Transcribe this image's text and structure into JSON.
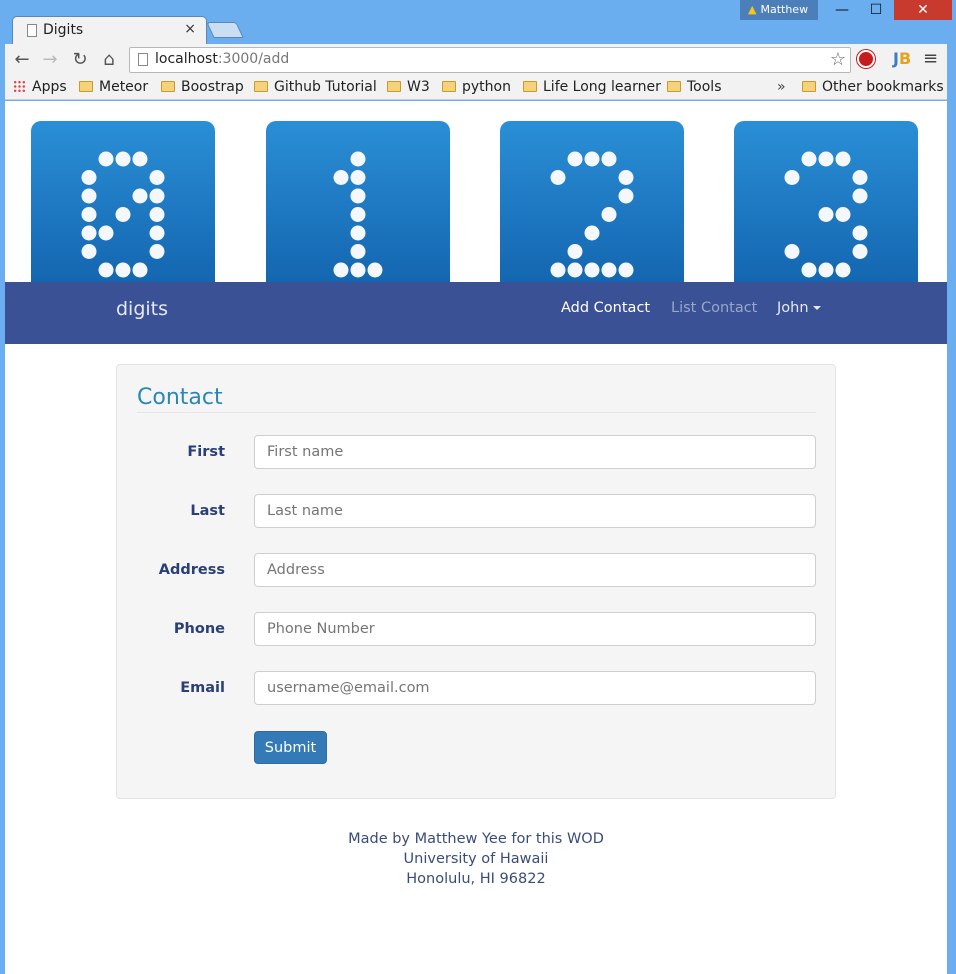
{
  "browser": {
    "tab_title": "Digits",
    "tab_close": "×",
    "profile_name": "Matthew",
    "url_host": "localhost",
    "url_path": ":3000/add",
    "bookmarks": [
      {
        "label": "Apps",
        "icon": "apps-grid-icon"
      },
      {
        "label": "Meteor",
        "icon": "folder-icon"
      },
      {
        "label": "Boostrap",
        "icon": "folder-icon"
      },
      {
        "label": "Github Tutorial",
        "icon": "folder-icon"
      },
      {
        "label": "W3",
        "icon": "folder-icon"
      },
      {
        "label": "python",
        "icon": "folder-icon"
      },
      {
        "label": "Life Long learner",
        "icon": "folder-icon"
      },
      {
        "label": "Tools",
        "icon": "folder-icon"
      }
    ],
    "overflow": "»",
    "other_bookmarks": "Other bookmarks"
  },
  "banner": {
    "digits": [
      "0",
      "1",
      "2",
      "3"
    ],
    "tile_color": "#1f7cc6"
  },
  "navbar": {
    "brand": "digits",
    "links": {
      "add_contact": "Add Contact",
      "list_contact": "List Contact",
      "user": "John"
    },
    "background": "#3a5195"
  },
  "form": {
    "legend": "Contact",
    "fields": [
      {
        "label": "First",
        "placeholder": "First name"
      },
      {
        "label": "Last",
        "placeholder": "Last name"
      },
      {
        "label": "Address",
        "placeholder": "Address"
      },
      {
        "label": "Phone",
        "placeholder": "Phone Number"
      },
      {
        "label": "Email",
        "placeholder": "username@email.com"
      }
    ],
    "submit_label": "Submit"
  },
  "footer": {
    "line1": "Made by Matthew Yee for this WOD",
    "line2": "University of Hawaii",
    "line3": "Honolulu, HI 96822"
  }
}
